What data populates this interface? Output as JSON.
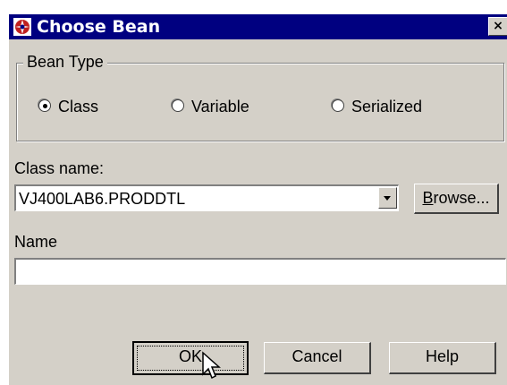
{
  "window": {
    "title": "Choose Bean",
    "close_glyph": "×",
    "icon": "java-bean-icon"
  },
  "bean_type": {
    "label": "Bean Type",
    "options": [
      {
        "label": "Class",
        "selected": true
      },
      {
        "label": "Variable",
        "selected": false
      },
      {
        "label": "Serialized",
        "selected": false
      }
    ]
  },
  "class_name": {
    "label": "Class name:",
    "value": "VJ400LAB6.PRODDTL",
    "browse_label_mnemonic": "B",
    "browse_label_rest": "rowse..."
  },
  "name": {
    "label": "Name",
    "value": ""
  },
  "buttons": {
    "ok": "OK",
    "cancel": "Cancel",
    "help": "Help"
  },
  "colors": {
    "titlebar": "#000080",
    "face": "#d4d0c8"
  }
}
